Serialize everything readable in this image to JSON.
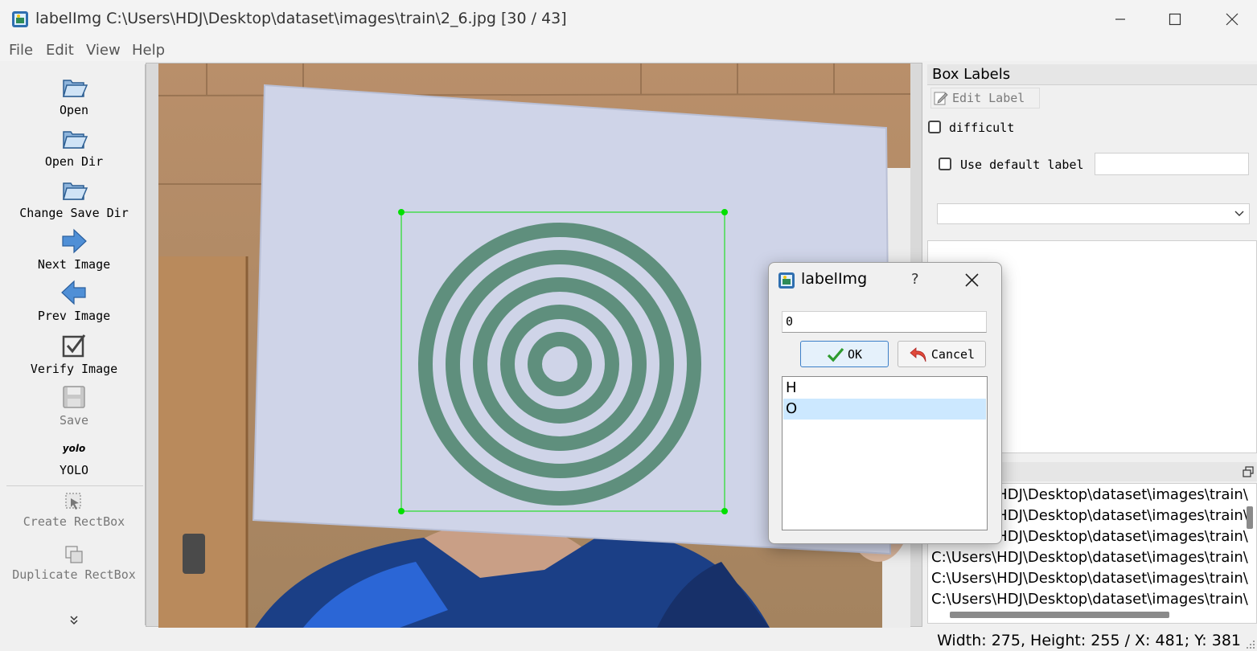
{
  "window": {
    "title": "labelImg C:\\Users\\HDJ\\Desktop\\dataset\\images\\train\\2_6.jpg [30 / 43]",
    "icons": {
      "app": "labelimg-app-icon",
      "minimize": "minimize-icon",
      "maximize": "maximize-icon",
      "close": "close-icon"
    }
  },
  "menu": [
    "File",
    "Edit",
    "View",
    "Help"
  ],
  "toolbar": {
    "items": [
      {
        "label": "Open",
        "icon": "folder-open-icon",
        "enabled": true
      },
      {
        "label": "Open Dir",
        "icon": "folder-open-icon",
        "enabled": true
      },
      {
        "label": "Change Save Dir",
        "icon": "folder-open-icon",
        "enabled": true
      },
      {
        "label": "Next Image",
        "icon": "arrow-right-icon",
        "enabled": true
      },
      {
        "label": "Prev Image",
        "icon": "arrow-left-icon",
        "enabled": true
      },
      {
        "label": "Verify Image",
        "icon": "checkbox-icon",
        "enabled": true
      },
      {
        "label": "Save",
        "icon": "floppy-icon",
        "enabled": false
      },
      {
        "label": "YOLO",
        "icon_text": "yolo",
        "enabled": true
      },
      {
        "label": "Create RectBox",
        "icon": "create-rect-icon",
        "enabled": false
      },
      {
        "label": "Duplicate RectBox",
        "icon": "duplicate-rect-icon",
        "enabled": false
      }
    ],
    "more_icon": "double-chevron-down-icon"
  },
  "right_panel": {
    "dock_title": "Box Labels",
    "edit_label_button": "Edit Label",
    "difficult_label": "difficult",
    "use_default_label": "Use default label",
    "default_label_value": "",
    "combo_value": "",
    "file_list": [
      "C:\\Users\\HDJ\\Desktop\\dataset\\images\\train\\",
      "C:\\Users\\HDJ\\Desktop\\dataset\\images\\train\\",
      "C:\\Users\\HDJ\\Desktop\\dataset\\images\\train\\",
      "C:\\Users\\HDJ\\Desktop\\dataset\\images\\train\\",
      "C:\\Users\\HDJ\\Desktop\\dataset\\images\\train\\",
      "C:\\Users\\HDJ\\Desktop\\dataset\\images\\train\\"
    ]
  },
  "dialog": {
    "title": "labelImg",
    "help": "?",
    "input_value": "0",
    "ok_label": "OK",
    "cancel_label": "Cancel",
    "labels": [
      "H",
      "O"
    ],
    "selected_label": "O"
  },
  "status": "Width: 275, Height: 255 / X: 481; Y: 381",
  "colors": {
    "bbox": "#00e000",
    "selection": "#cce8ff",
    "ok_border": "#3c7fc8",
    "target_ring": "#5f8f7d"
  }
}
